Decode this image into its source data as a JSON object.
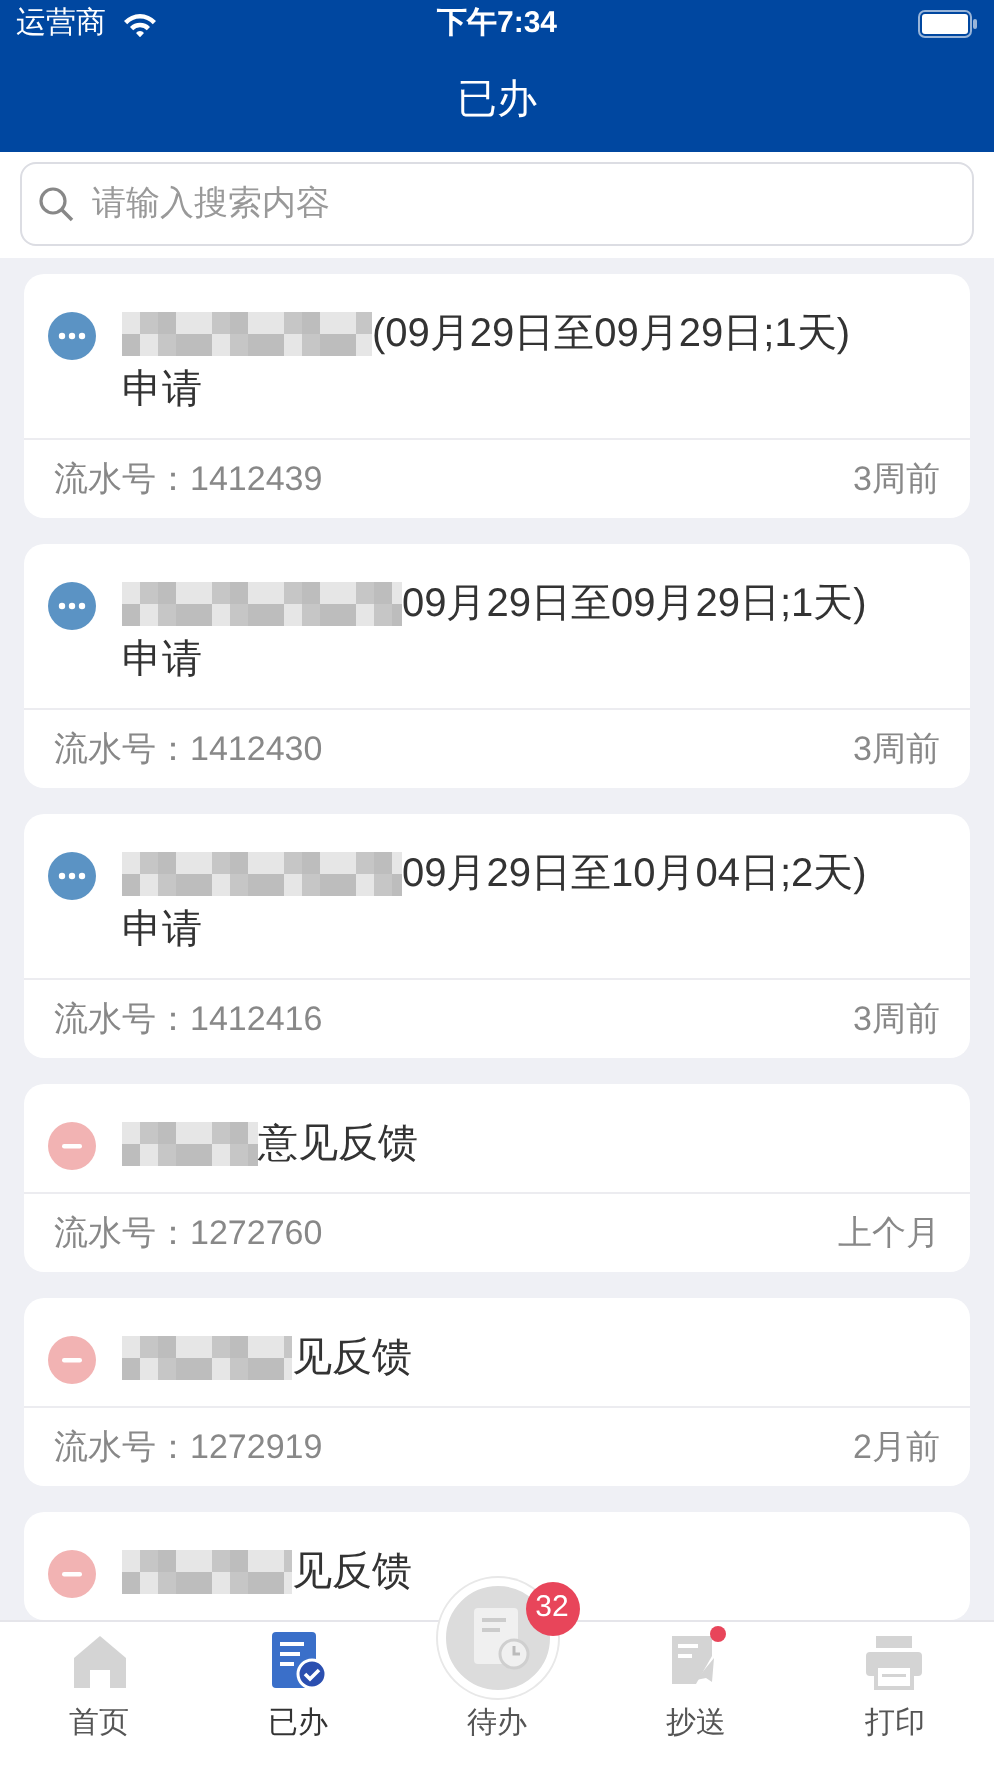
{
  "status_bar": {
    "carrier": "运营商",
    "time": "下午7:34"
  },
  "nav": {
    "title": "已办"
  },
  "search": {
    "placeholder": "请输入搜索内容"
  },
  "cards": [
    {
      "kind": "pending",
      "title_lines": [
        "(09月29日至09月29日;1天)",
        "申请"
      ],
      "serial_label": "流水号：",
      "serial": "1412439",
      "age": "3周前"
    },
    {
      "kind": "pending",
      "title_lines": [
        "09月29日至09月29日;1天)",
        "申请"
      ],
      "serial_label": "流水号：",
      "serial": "1412430",
      "age": "3周前"
    },
    {
      "kind": "pending",
      "title_lines": [
        "09月29日至10月04日;2天)",
        "申请"
      ],
      "serial_label": "流水号：",
      "serial": "1412416",
      "age": "3周前"
    },
    {
      "kind": "rejected",
      "title_lines": [
        "意见反馈"
      ],
      "serial_label": "流水号：",
      "serial": "1272760",
      "age": "上个月"
    },
    {
      "kind": "rejected",
      "title_lines": [
        "见反馈"
      ],
      "serial_label": "流水号：",
      "serial": "1272919",
      "age": "2月前"
    },
    {
      "kind": "rejected",
      "title_lines": [
        "见反馈"
      ]
    }
  ],
  "tabs": [
    {
      "kind": "home",
      "label": "首页",
      "selected": false
    },
    {
      "kind": "done",
      "label": "已办",
      "selected": true
    },
    {
      "kind": "todo",
      "label": "待办",
      "selected": false,
      "badge": "32"
    },
    {
      "kind": "cc",
      "label": "抄送",
      "selected": false,
      "dot": true
    },
    {
      "kind": "print",
      "label": "打印",
      "selected": false
    }
  ]
}
